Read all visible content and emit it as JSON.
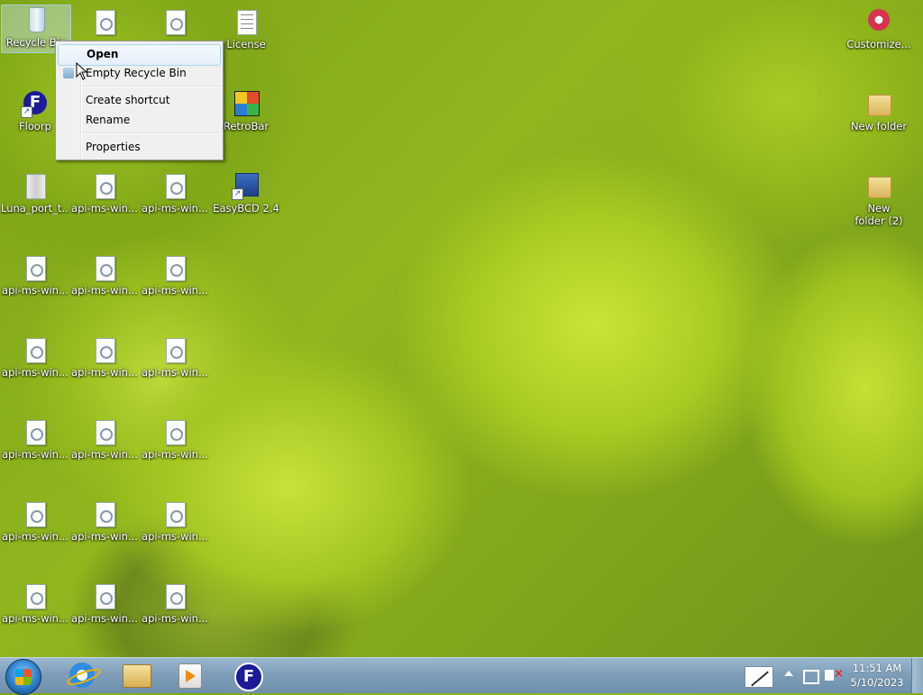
{
  "desktop": {
    "icons": [
      {
        "label": "Recycle Bin",
        "icon": "recycle-bin-icon"
      },
      {
        "label": "",
        "icon": "system-file-icon"
      },
      {
        "label": "",
        "icon": "system-file-icon"
      },
      {
        "label": "License",
        "icon": "text-file-icon"
      },
      {
        "label": "Customize...",
        "icon": "customize-gear-icon"
      },
      {
        "label": "Floorp",
        "icon": "floorp-icon"
      },
      {
        "label": "RetroBar",
        "icon": "retrobar-icon"
      },
      {
        "label": "New folder",
        "icon": "folder-icon"
      },
      {
        "label": "Luna_port_t...",
        "icon": "archive-icon"
      },
      {
        "label": "api-ms-win...",
        "icon": "system-file-icon"
      },
      {
        "label": "api-ms-win...",
        "icon": "system-file-icon"
      },
      {
        "label": "EasyBCD 2.4",
        "icon": "easybcd-icon"
      },
      {
        "label": "New folder (2)",
        "icon": "folder-icon"
      },
      {
        "label": "api-ms-win...",
        "icon": "system-file-icon"
      },
      {
        "label": "api-ms-win...",
        "icon": "system-file-icon"
      },
      {
        "label": "api-ms-win...",
        "icon": "system-file-icon"
      },
      {
        "label": "api-ms-win...",
        "icon": "system-file-icon"
      },
      {
        "label": "api-ms-win...",
        "icon": "system-file-icon"
      },
      {
        "label": "api-ms-win...",
        "icon": "system-file-icon"
      },
      {
        "label": "api-ms-win...",
        "icon": "system-file-icon"
      },
      {
        "label": "api-ms-win...",
        "icon": "system-file-icon"
      },
      {
        "label": "api-ms-win...",
        "icon": "system-file-icon"
      },
      {
        "label": "api-ms-win...",
        "icon": "system-file-icon"
      },
      {
        "label": "api-ms-win...",
        "icon": "system-file-icon"
      },
      {
        "label": "api-ms-win...",
        "icon": "system-file-icon"
      },
      {
        "label": "api-ms-win...",
        "icon": "system-file-icon"
      },
      {
        "label": "api-ms-win...",
        "icon": "system-file-icon"
      },
      {
        "label": "api-ms-win...",
        "icon": "system-file-icon"
      }
    ]
  },
  "context_menu": {
    "open": "Open",
    "empty_recycle_bin": "Empty Recycle Bin",
    "create_shortcut": "Create shortcut",
    "rename": "Rename",
    "properties": "Properties"
  },
  "taskbar": {
    "start_icon": "windows-start-icon",
    "pinned": [
      "internet-explorer-icon",
      "file-explorer-icon",
      "media-player-icon",
      "floorp-icon"
    ],
    "tray_icons": [
      "pen-input-icon",
      "show-hidden-icons-chevron-icon",
      "network-icon",
      "volume-muted-icon"
    ],
    "clock_time": "11:51 AM",
    "clock_date": "5/10/2023"
  }
}
